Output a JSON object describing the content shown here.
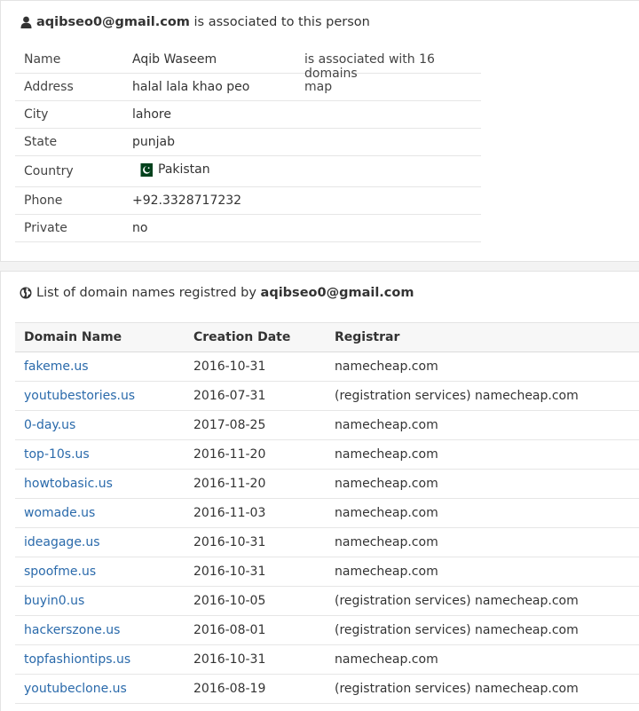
{
  "person": {
    "heading_email": "aqibseo0@gmail.com",
    "heading_suffix": " is associated to this person",
    "rows": [
      {
        "label": "Name",
        "value": "Aqib Waseem",
        "extra": "is associated with 16 domains"
      },
      {
        "label": "Address",
        "value": "halal lala khao peo",
        "extra": "map"
      },
      {
        "label": "City",
        "value": "lahore"
      },
      {
        "label": "State",
        "value": "punjab"
      },
      {
        "label": "Country",
        "value": "Pakistan"
      },
      {
        "label": "Phone",
        "value": "+92.3328717232"
      },
      {
        "label": "Private",
        "value": "no"
      }
    ]
  },
  "domains": {
    "heading_prefix": "List of domain names registred by ",
    "heading_email": "aqibseo0@gmail.com",
    "columns": [
      "Domain Name",
      "Creation Date",
      "Registrar"
    ],
    "rows": [
      {
        "domain": "fakeme.us",
        "date": "2016-10-31",
        "registrar": "namecheap.com"
      },
      {
        "domain": "youtubestories.us",
        "date": "2016-07-31",
        "registrar": "(registration services) namecheap.com"
      },
      {
        "domain": "0-day.us",
        "date": "2017-08-25",
        "registrar": "namecheap.com"
      },
      {
        "domain": "top-10s.us",
        "date": "2016-11-20",
        "registrar": "namecheap.com"
      },
      {
        "domain": "howtobasic.us",
        "date": "2016-11-20",
        "registrar": "namecheap.com"
      },
      {
        "domain": "womade.us",
        "date": "2016-11-03",
        "registrar": "namecheap.com"
      },
      {
        "domain": "ideagage.us",
        "date": "2016-10-31",
        "registrar": "namecheap.com"
      },
      {
        "domain": "spoofme.us",
        "date": "2016-10-31",
        "registrar": "namecheap.com"
      },
      {
        "domain": "buyin0.us",
        "date": "2016-10-05",
        "registrar": "(registration services) namecheap.com"
      },
      {
        "domain": "hackerszone.us",
        "date": "2016-08-01",
        "registrar": "(registration services) namecheap.com"
      },
      {
        "domain": "topfashiontips.us",
        "date": "2016-10-31",
        "registrar": "namecheap.com"
      },
      {
        "domain": "youtubeclone.us",
        "date": "2016-08-19",
        "registrar": "(registration services) namecheap.com"
      }
    ]
  },
  "colors": {
    "link": "#2a6aab",
    "flag_green": "#01411c"
  },
  "icons": {
    "person": "user-icon",
    "domains": "globe-icon",
    "country": "pakistan-flag-icon"
  }
}
